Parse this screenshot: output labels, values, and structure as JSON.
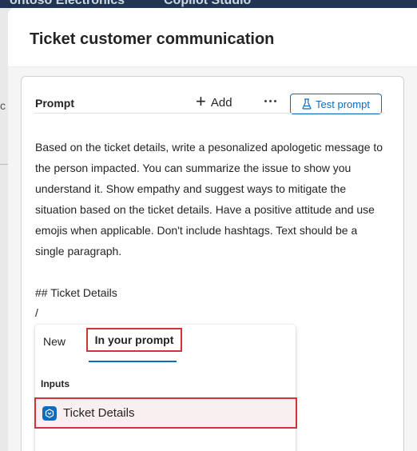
{
  "background": {
    "app_name": "ontoso Electronics",
    "product_name": "Copilot Studio",
    "side_glyph": "c"
  },
  "panel": {
    "title": "Ticket customer communication"
  },
  "prompt_card": {
    "label": "Prompt",
    "add_label": "Add",
    "more_icon": "more-horizontal-icon",
    "test_label": "Test prompt",
    "test_icon": "beaker-icon",
    "body_text": "Based on the ticket details, write a pesonalized apologetic message to the person impacted. You can summarize the issue to show you understand it. Show empathy and suggest ways to mitigate the situation based on the ticket details. Have a positive attitude and use emojis when applicable. Don't include hashtags. Text should be a single paragraph.",
    "ticket_heading": "## Ticket Details",
    "slash": "/"
  },
  "flyout": {
    "tabs": [
      {
        "label": "New",
        "selected": false
      },
      {
        "label": "In your prompt",
        "selected": true
      }
    ],
    "section_label": "Inputs",
    "items": [
      {
        "label": "Ticket Details",
        "icon": "input-variable-icon"
      }
    ]
  },
  "colors": {
    "accent": "#0f6cbd",
    "highlight_border": "#d13438",
    "highlight_fill": "#f9eef0",
    "topbar": "#1f3552"
  }
}
